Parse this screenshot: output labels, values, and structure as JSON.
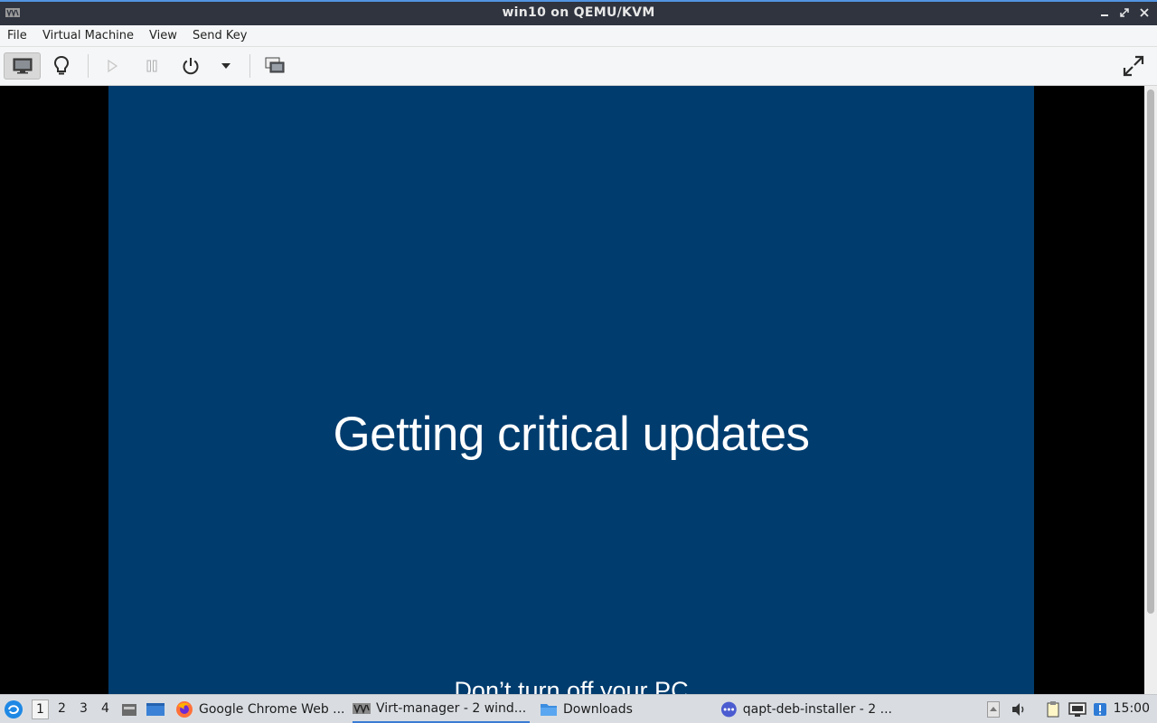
{
  "window": {
    "title": "win10 on QEMU/KVM",
    "controls": [
      "minimize-icon",
      "maximize-icon",
      "close-icon"
    ]
  },
  "menubar": {
    "items": [
      "File",
      "Virtual Machine",
      "View",
      "Send Key"
    ]
  },
  "toolbar": {
    "buttons": [
      "console-icon",
      "lightbulb-icon",
      "play-icon",
      "pause-icon",
      "power-icon",
      "dropdown-arrow-icon",
      "snapshot-icon",
      "fullscreen-icon"
    ]
  },
  "guest": {
    "heading": "Getting critical updates",
    "subtext": "Don’t turn off your PC",
    "background": "#003c6e"
  },
  "taskbar": {
    "workspaces": [
      "1",
      "2",
      "3",
      "4"
    ],
    "active_workspace": "1",
    "tasks": [
      {
        "label": "Google Chrome Web ...",
        "icon": "firefox-icon"
      },
      {
        "label": "Virt-manager - 2 wind...",
        "icon": "virt-manager-icon",
        "active": true
      },
      {
        "label": "Downloads",
        "icon": "folder-icon"
      },
      {
        "label": "qapt-deb-installer - 2 ...",
        "icon": "installer-icon"
      }
    ],
    "clock": "15:00"
  },
  "colors": {
    "titlebar": "#2f343f",
    "accent": "#5294e2",
    "guest_bg": "#003c6e"
  }
}
